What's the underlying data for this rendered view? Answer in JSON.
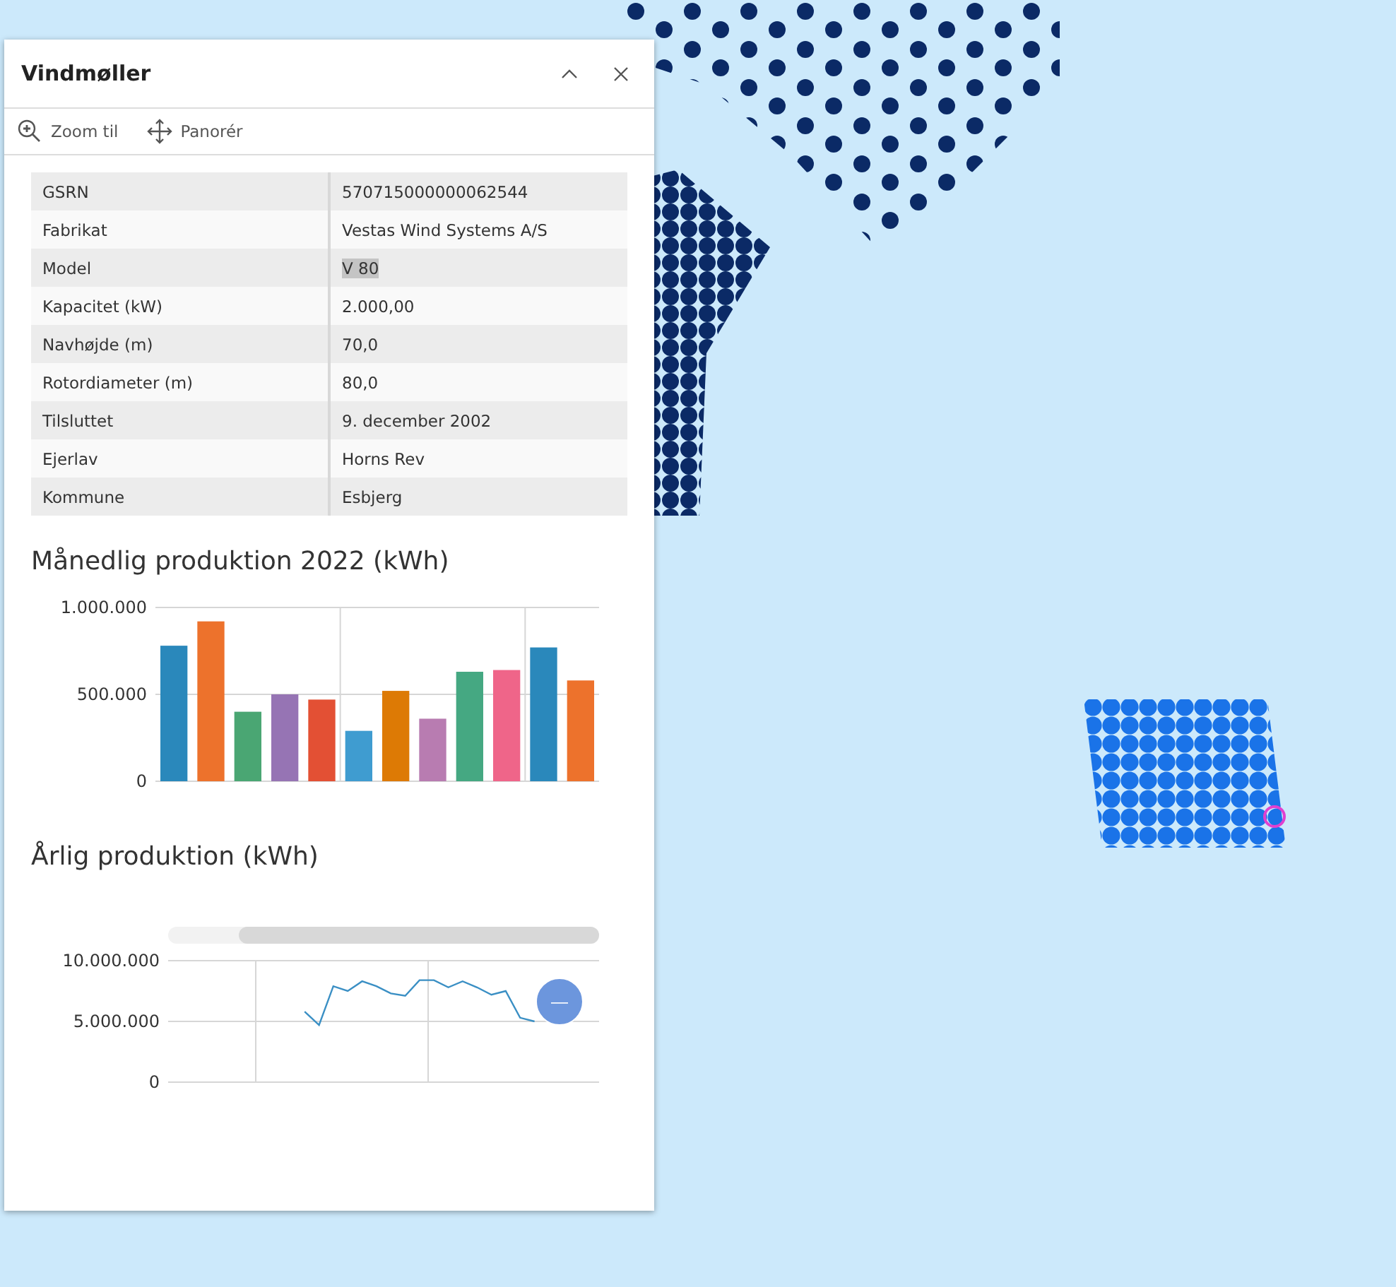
{
  "window": {
    "title": "Vindmøller"
  },
  "toolbar": [
    {
      "kind": "zoom",
      "label": "Zoom til"
    },
    {
      "kind": "pan",
      "label": "Panorér"
    }
  ],
  "attributes": [
    {
      "label": "GSRN",
      "value": "570715000000062544",
      "highlighted": false
    },
    {
      "label": "Fabrikat",
      "value": "Vestas Wind Systems A/S",
      "highlighted": false
    },
    {
      "label": "Model",
      "value": "V 80",
      "highlighted": true
    },
    {
      "label": "Kapacitet (kW)",
      "value": "2.000,00",
      "highlighted": false
    },
    {
      "label": "Navhøjde (m)",
      "value": "70,0",
      "highlighted": false
    },
    {
      "label": "Rotordiameter (m)",
      "value": "80,0",
      "highlighted": false
    },
    {
      "label": "Tilsluttet",
      "value": "9. december 2002",
      "highlighted": false
    },
    {
      "label": "Ejerlav",
      "value": "Horns Rev",
      "highlighted": false
    },
    {
      "label": "Kommune",
      "value": "Esbjerg",
      "highlighted": false
    }
  ],
  "monthly": {
    "title": "Månedlig produktion 2022 (kWh)",
    "chart_data": {
      "type": "bar",
      "ylim": [
        0,
        1000000
      ],
      "yticks": [
        {
          "value": 0,
          "label": "0"
        },
        {
          "value": 500000,
          "label": "500.000"
        },
        {
          "value": 1000000,
          "label": "1.000.000"
        }
      ],
      "values": [
        780000,
        920000,
        400000,
        500000,
        470000,
        290000,
        520000,
        360000,
        630000,
        640000,
        770000,
        580000
      ],
      "colors": [
        "#2a88bb",
        "#ed722c",
        "#4aa673",
        "#9674b4",
        "#e35034",
        "#3f9cd0",
        "#dd7a05",
        "#b87cb1",
        "#45a882",
        "#ef6589",
        "#2a88bb",
        "#ed722c"
      ]
    }
  },
  "yearly": {
    "title": "Årlig produktion (kWh)",
    "zoom_out_icon": "—",
    "chart_data": {
      "type": "line",
      "ylim": [
        0,
        10000000
      ],
      "yticks": [
        {
          "value": 0,
          "label": "0"
        },
        {
          "value": 5000000,
          "label": "5.000.000"
        },
        {
          "value": 10000000,
          "label": "10.000.000"
        }
      ],
      "series": [
        {
          "color": "#3a8fc4",
          "values": [
            null,
            null,
            null,
            null,
            null,
            null,
            null,
            null,
            null,
            5800000,
            4700000,
            7900000,
            7500000,
            8300000,
            7900000,
            7300000,
            7100000,
            8400000,
            8400000,
            7800000,
            8300000,
            7800000,
            7200000,
            7500000,
            5300000,
            5000000,
            null,
            null,
            null,
            null
          ]
        }
      ]
    }
  }
}
